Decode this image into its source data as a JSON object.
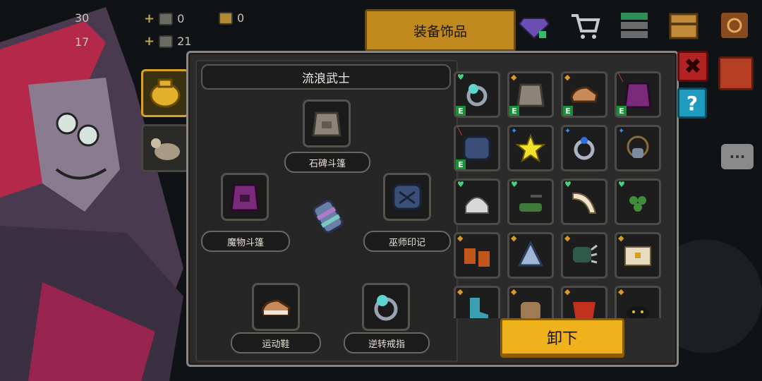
{
  "hud": {
    "stat_1": "30",
    "stat_2": "17",
    "material_1_count": "0",
    "material_2_count": "21",
    "material_3_count": "0"
  },
  "top_tab": {
    "label": "装备饰品"
  },
  "loadout": {
    "character_name": "流浪武士",
    "slots": {
      "top": "石碑斗篷",
      "left": "魔物斗篷",
      "right": "巫师印记",
      "bottom_left": "运动鞋",
      "bottom_right": "逆转戒指"
    }
  },
  "inventory": {
    "badge_equipped": "E"
  },
  "actions": {
    "unequip_label": "卸下",
    "help_label": "?",
    "close_label": "✖"
  },
  "colors": {
    "accent_gold": "#f0b21c",
    "close_red": "#b32323",
    "help_blue": "#1f9bc0"
  }
}
